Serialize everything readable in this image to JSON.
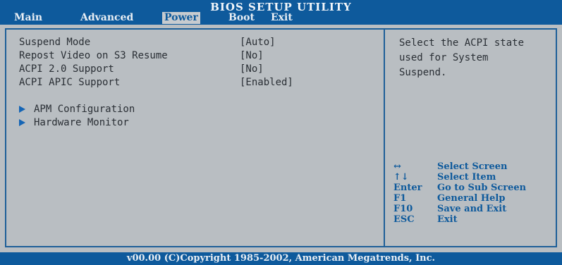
{
  "title": "BIOS SETUP UTILITY",
  "tabs": [
    {
      "label": "Main",
      "active": false
    },
    {
      "label": "Advanced",
      "active": false
    },
    {
      "label": "Power",
      "active": true
    },
    {
      "label": "Boot",
      "active": false
    },
    {
      "label": "Exit",
      "active": false
    }
  ],
  "settings": [
    {
      "label": "Suspend Mode",
      "value": "[Auto]"
    },
    {
      "label": "Repost Video on S3 Resume",
      "value": "[No]"
    },
    {
      "label": "ACPI 2.0 Support",
      "value": "[No]"
    },
    {
      "label": "ACPI APIC Support",
      "value": "[Enabled]"
    }
  ],
  "submenus": [
    {
      "label": "APM Configuration"
    },
    {
      "label": "Hardware Monitor"
    }
  ],
  "help": {
    "lines": [
      "Select the ACPI state",
      "used for System",
      "Suspend."
    ]
  },
  "keys": [
    {
      "key": "↔",
      "action": "Select Screen"
    },
    {
      "key": "↑↓",
      "action": "Select Item"
    },
    {
      "key": "Enter",
      "action": "Go to Sub Screen"
    },
    {
      "key": "F1",
      "action": "General Help"
    },
    {
      "key": "F10",
      "action": "Save and Exit"
    },
    {
      "key": "ESC",
      "action": "Exit"
    }
  ],
  "footer": "v00.00 (C)Copyright 1985-2002, American Megatrends, Inc.",
  "colors": {
    "header_bg": "#0e5a9c",
    "panel_bg": "#b9bec2",
    "text": "#2a2f35",
    "accent": "#1565b5"
  },
  "icons": {
    "submenu_marker": "triangle-right-icon"
  }
}
